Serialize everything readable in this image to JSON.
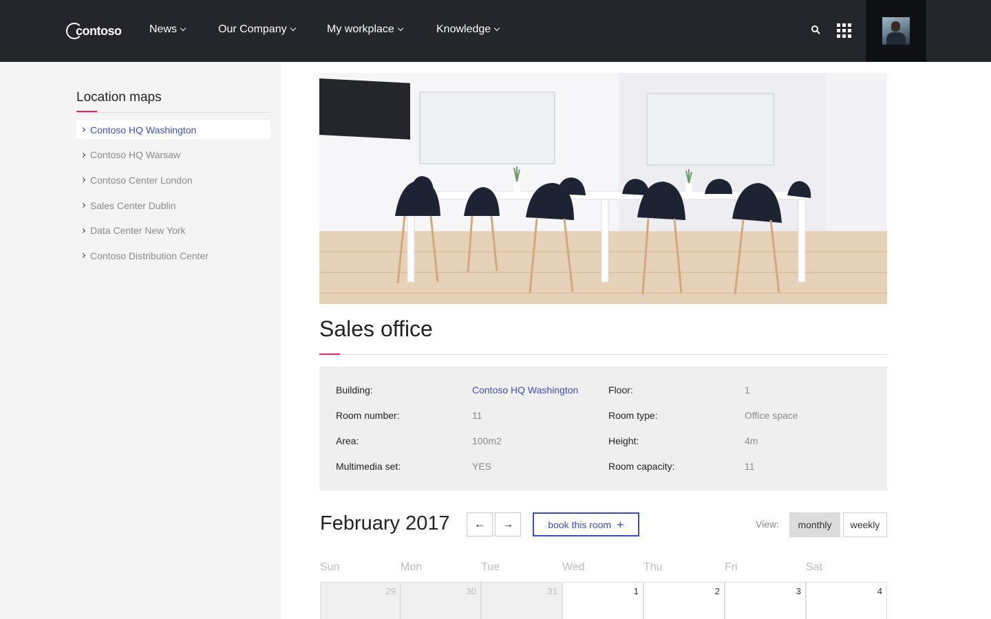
{
  "header": {
    "logo_text": "contoso",
    "nav": [
      {
        "label": "News"
      },
      {
        "label": "Our Company"
      },
      {
        "label": "My workplace"
      },
      {
        "label": "Knowledge"
      }
    ]
  },
  "sidebar": {
    "title": "Location maps",
    "items": [
      {
        "label": "Contoso HQ Washington",
        "active": true
      },
      {
        "label": "Contoso HQ Warsaw"
      },
      {
        "label": "Contoso Center London"
      },
      {
        "label": "Sales Center Dublin"
      },
      {
        "label": "Data Center New York"
      },
      {
        "label": "Contoso Distribution Center"
      }
    ]
  },
  "room": {
    "title": "Sales office",
    "details": [
      {
        "label": "Building:",
        "value": "Contoso HQ Washington",
        "link": true
      },
      {
        "label": "Floor:",
        "value": "1"
      },
      {
        "label": "Room number:",
        "value": "11"
      },
      {
        "label": "Room type:",
        "value": "Office space"
      },
      {
        "label": "Area:",
        "value": "100m2"
      },
      {
        "label": "Height:",
        "value": "4m"
      },
      {
        "label": "Multimedia set:",
        "value": "YES"
      },
      {
        "label": "Room capacity:",
        "value": "11"
      }
    ]
  },
  "calendar": {
    "month_label": "February 2017",
    "prev_glyph": "←",
    "next_glyph": "→",
    "book_label": "book this room",
    "book_glyph": "+",
    "view_label": "View:",
    "views": [
      "monthly",
      "weekly"
    ],
    "selected_view": "monthly",
    "weekdays": [
      "Sun",
      "Mon",
      "Tue",
      "Wed",
      "Thu",
      "Fri",
      "Sat"
    ],
    "first_week": [
      {
        "day": "29",
        "other_month": true
      },
      {
        "day": "30",
        "other_month": true
      },
      {
        "day": "31",
        "other_month": true
      },
      {
        "day": "1"
      },
      {
        "day": "2"
      },
      {
        "day": "3"
      },
      {
        "day": "4"
      }
    ]
  },
  "colors": {
    "topbar": "#25262b",
    "accent": "#e5246b",
    "link": "#3b4cc0",
    "sidebar_bg": "#f4f4f4"
  }
}
